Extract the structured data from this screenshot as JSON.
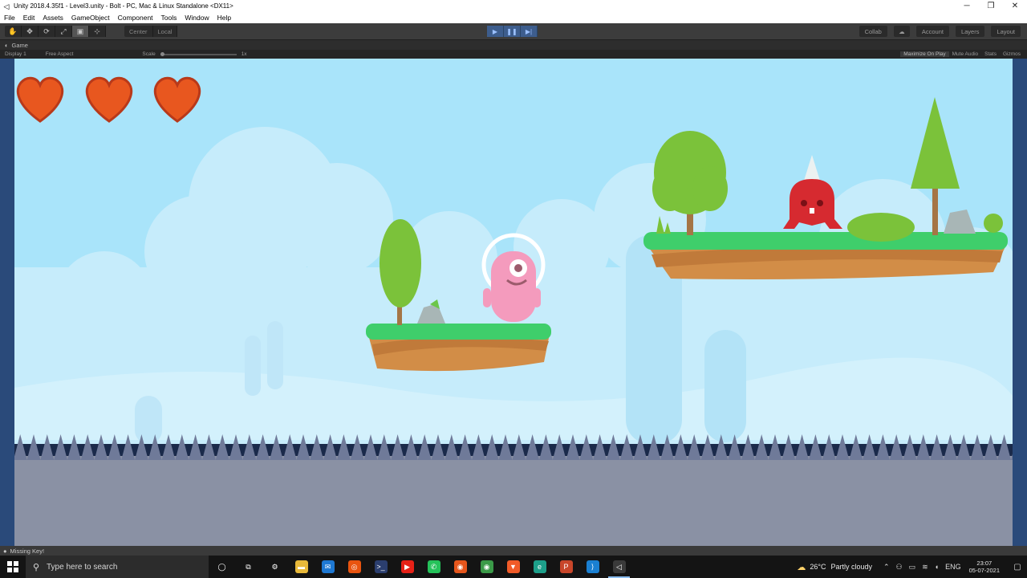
{
  "window": {
    "title": "Unity 2018.4.35f1 - Level3.unity - Bolt - PC, Mac & Linux Standalone <DX11>",
    "controls": [
      "─",
      "❐",
      "✕"
    ]
  },
  "menu": [
    "File",
    "Edit",
    "Assets",
    "GameObject",
    "Component",
    "Tools",
    "Window",
    "Help"
  ],
  "toolbar": {
    "tools": [
      {
        "icon": "hand-icon",
        "glyph": "✋"
      },
      {
        "icon": "move-icon",
        "glyph": "✥"
      },
      {
        "icon": "rotate-icon",
        "glyph": "⟳"
      },
      {
        "icon": "scale-icon",
        "glyph": "⤢"
      },
      {
        "icon": "rect-icon",
        "glyph": "▣"
      },
      {
        "icon": "transform-icon",
        "glyph": "⊹"
      }
    ],
    "pivot": "Center",
    "pivot_space": "Local",
    "play": {
      "glyph": "▶"
    },
    "pause": {
      "glyph": "❚❚"
    },
    "step": {
      "glyph": "▶|"
    },
    "collab": "Collab",
    "account": "Account",
    "layers": "Layers",
    "layout": "Layout"
  },
  "game_tab": {
    "label": "Game",
    "display": "Display 1",
    "aspect": "Free Aspect",
    "scale_label": "Scale",
    "scale_value": "1x",
    "maximize": "Maximize On Play",
    "mute": "Mute Audio",
    "stats": "Stats",
    "gizmos": "Gizmos"
  },
  "hud": {
    "hearts": 3
  },
  "status": {
    "message": "Missing Key!"
  },
  "taskbar": {
    "search_placeholder": "Type here to search",
    "apps": [
      {
        "name": "cortana",
        "glyph": "◯",
        "color": "transparent"
      },
      {
        "name": "task-view",
        "glyph": "⧉",
        "color": "transparent"
      },
      {
        "name": "settings",
        "glyph": "⚙",
        "color": "transparent"
      },
      {
        "name": "file-explorer",
        "glyph": "▬",
        "color": "#e8b93a"
      },
      {
        "name": "mail",
        "glyph": "✉",
        "color": "#1e78d2"
      },
      {
        "name": "ubuntu",
        "glyph": "◎",
        "color": "#e9540f"
      },
      {
        "name": "terminal",
        "glyph": ">_",
        "color": "#2b3e6e"
      },
      {
        "name": "youtube-music",
        "glyph": "▶",
        "color": "#e62117"
      },
      {
        "name": "whatsapp",
        "glyph": "✆",
        "color": "#25c25a"
      },
      {
        "name": "firefox",
        "glyph": "◉",
        "color": "#e6561c"
      },
      {
        "name": "chrome",
        "glyph": "◉",
        "color": "#3b9a48"
      },
      {
        "name": "brave",
        "glyph": "▼",
        "color": "#f15b28"
      },
      {
        "name": "edge",
        "glyph": "e",
        "color": "#1d9f8a"
      },
      {
        "name": "powerpoint",
        "glyph": "P",
        "color": "#c8462a"
      },
      {
        "name": "vscode",
        "glyph": "⟩",
        "color": "#1a7fd1"
      },
      {
        "name": "unity",
        "glyph": "◁",
        "color": "#3a3a3a"
      }
    ],
    "weather_temp": "26°C",
    "weather_text": "Partly cloudy",
    "lang": "ENG",
    "time": "23:07",
    "date": "05-07-2021"
  }
}
